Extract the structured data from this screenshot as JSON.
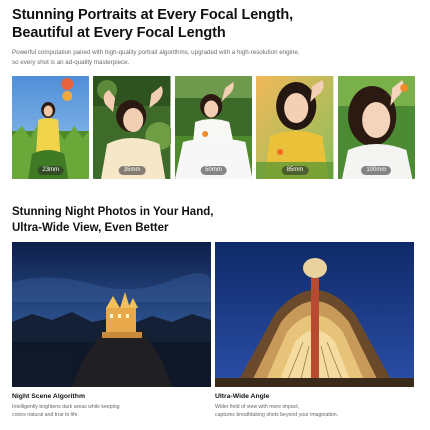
{
  "hero": {
    "title_line1": "Stunning Portraits at Every Focal Length,",
    "title_line2": "Beautiful at Every Focal Length",
    "desc_line1": "Powerful computation paired with high-quality portrait algorithms, upgraded with a high-resolution engine,",
    "desc_line2": "so every shot is an ad-quality masterpiece."
  },
  "portraits": [
    {
      "focal": "23mm"
    },
    {
      "focal": "35mm"
    },
    {
      "focal": "50mm"
    },
    {
      "focal": "85mm"
    },
    {
      "focal": "100mm"
    }
  ],
  "night": {
    "title_line1": "Stunning Night Photos in Your Hand,",
    "title_line2": "Ultra-Wide View, Even Better"
  },
  "features": [
    {
      "title": "Night Scene Algorithm",
      "text_line1": "Intelligently brightens dark areas while keeping",
      "text_line2": "colors natural and true to life."
    },
    {
      "title": "Ultra-Wide Angle",
      "text_line1": "Wider field of view with more impact,",
      "text_line2": "captures breathtaking shots beyond your imagination."
    }
  ]
}
